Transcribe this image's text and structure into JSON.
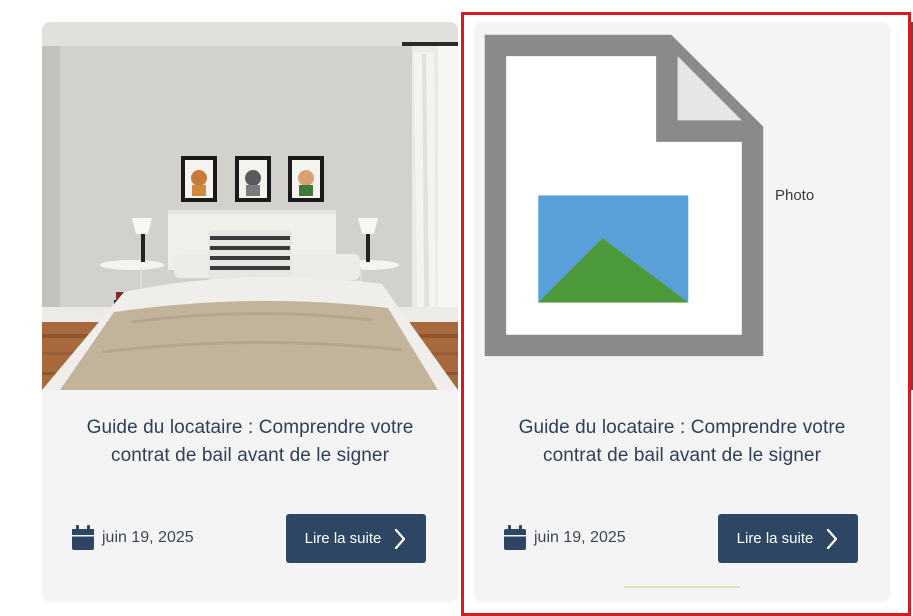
{
  "cards": [
    {
      "title": "Guide du locataire : Comprendre votre contrat de bail avant de le signer",
      "date": "juin 19, 2025",
      "button_label": "Lire la suite",
      "image_alt": "Photo",
      "image_loaded": true
    },
    {
      "title": "Guide du locataire : Comprendre votre contrat de bail avant de le signer",
      "date": "juin 19, 2025",
      "button_label": "Lire la suite",
      "image_alt": "Photo",
      "image_loaded": false
    }
  ],
  "icons": {
    "date": "calendar-icon",
    "button": "chevron-right-icon",
    "broken_image": "broken-image-icon"
  },
  "colors": {
    "card_bg": "#f4f4f4",
    "button_bg": "#2d4663",
    "text": "#2f3f55",
    "focus_outline": "#d71920"
  }
}
